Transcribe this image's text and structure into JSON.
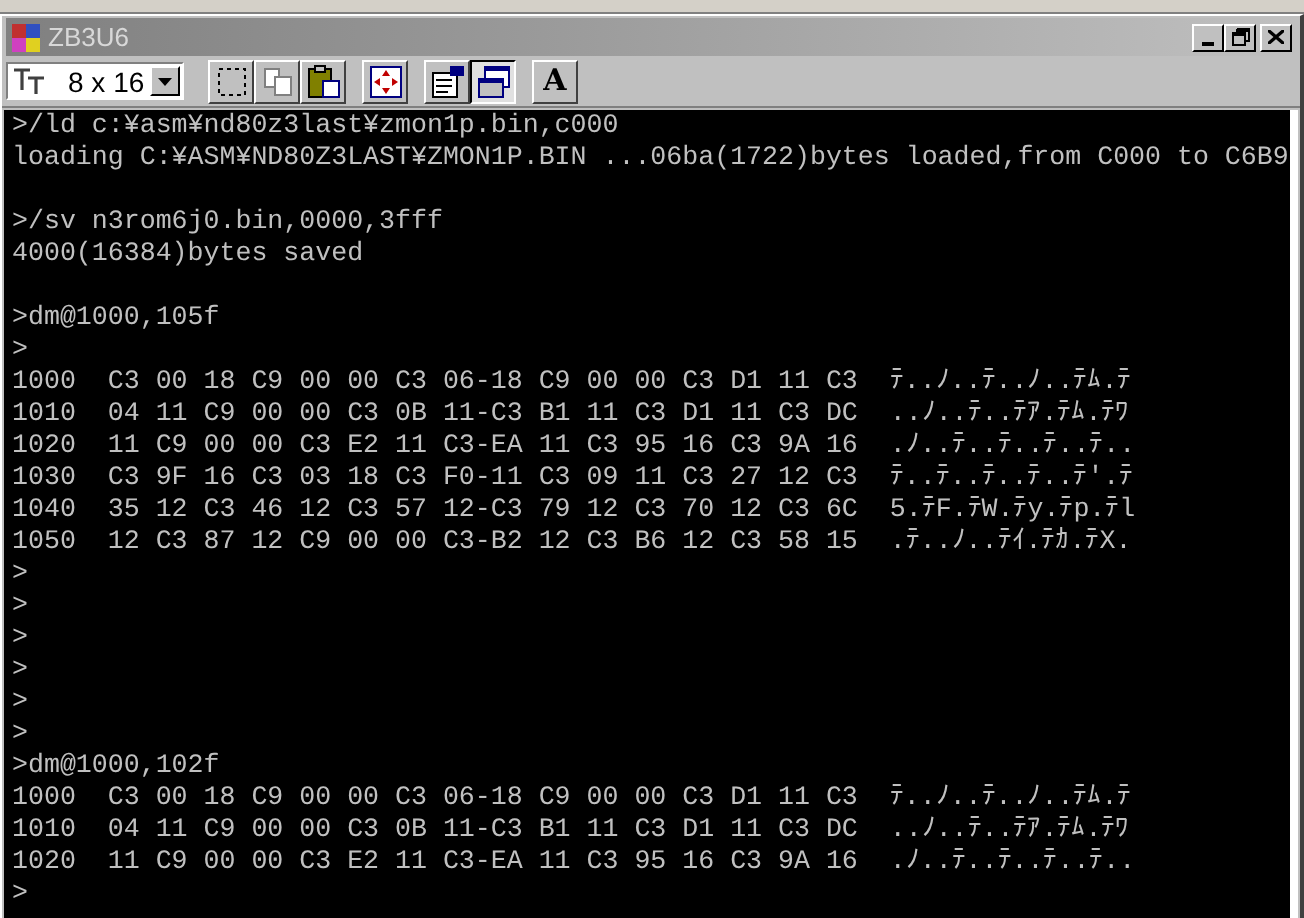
{
  "window": {
    "title": "ZB3U6"
  },
  "toolbar": {
    "font_size": "8 x 16",
    "buttons": [
      {
        "kind": "mark",
        "selected": false
      },
      {
        "kind": "copy",
        "selected": false
      },
      {
        "kind": "paste",
        "selected": false
      },
      {
        "kind": "fullscreen",
        "selected": false
      },
      {
        "kind": "properties",
        "selected": false
      },
      {
        "kind": "background",
        "selected": true
      },
      {
        "kind": "font",
        "label": "A",
        "selected": false
      }
    ]
  },
  "console": {
    "lines": [
      {
        "text": ">/ld c:¥asm¥nd80z3last¥zmon1p.bin,c000",
        "blank_line_before": false
      },
      {
        "text": "loading C:¥ASM¥ND80Z3LAST¥ZMON1P.BIN ...06ba(1722)bytes loaded,from C000 to C6B9",
        "blank_line_before": false
      },
      {
        "text": ">/sv n3rom6j0.bin,0000,3fff",
        "blank_line_before": true
      },
      {
        "text": "4000(16384)bytes saved",
        "blank_line_before": false
      },
      {
        "text": ">dm@1000,105f",
        "blank_line_before": true
      },
      {
        "text": ">",
        "blank_line_before": false
      },
      {
        "text": "1000  C3 00 18 C9 00 00 C3 06-18 C9 00 00 C3 D1 11 C3  ﾃ..ﾉ..ﾃ..ﾉ..ﾃﾑ.ﾃ",
        "blank_line_before": false
      },
      {
        "text": "1010  04 11 C9 00 00 C3 0B 11-C3 B1 11 C3 D1 11 C3 DC  ..ﾉ..ﾃ..ﾃｱ.ﾃﾑ.ﾃﾜ",
        "blank_line_before": false
      },
      {
        "text": "1020  11 C9 00 00 C3 E2 11 C3-EA 11 C3 95 16 C3 9A 16  .ﾉ..ﾃ..ﾃ..ﾃ..ﾃ..",
        "blank_line_before": false
      },
      {
        "text": "1030  C3 9F 16 C3 03 18 C3 F0-11 C3 09 11 C3 27 12 C3  ﾃ..ﾃ..ﾃ..ﾃ..ﾃ'.ﾃ",
        "blank_line_before": false
      },
      {
        "text": "1040  35 12 C3 46 12 C3 57 12-C3 79 12 C3 70 12 C3 6C  5.ﾃF.ﾃW.ﾃy.ﾃp.ﾃl",
        "blank_line_before": false
      },
      {
        "text": "1050  12 C3 87 12 C9 00 00 C3-B2 12 C3 B6 12 C3 58 15  .ﾃ..ﾉ..ﾃｲ.ﾃｶ.ﾃX.",
        "blank_line_before": false
      },
      {
        "text": ">",
        "blank_line_before": false
      },
      {
        "text": ">",
        "blank_line_before": false
      },
      {
        "text": ">",
        "blank_line_before": false
      },
      {
        "text": ">",
        "blank_line_before": false
      },
      {
        "text": ">",
        "blank_line_before": false
      },
      {
        "text": ">",
        "blank_line_before": false
      },
      {
        "text": ">dm@1000,102f",
        "blank_line_before": false
      },
      {
        "text": "1000  C3 00 18 C9 00 00 C3 06-18 C9 00 00 C3 D1 11 C3  ﾃ..ﾉ..ﾃ..ﾉ..ﾃﾑ.ﾃ",
        "blank_line_before": false
      },
      {
        "text": "1010  04 11 C9 00 00 C3 0B 11-C3 B1 11 C3 D1 11 C3 DC  ..ﾉ..ﾃ..ﾃｱ.ﾃﾑ.ﾃﾜ",
        "blank_line_before": false
      },
      {
        "text": "1020  11 C9 00 00 C3 E2 11 C3-EA 11 C3 95 16 C3 9A 16  .ﾉ..ﾃ..ﾃ..ﾃ..ﾃ..",
        "blank_line_before": false
      },
      {
        "text": ">",
        "blank_line_before": false
      }
    ]
  }
}
